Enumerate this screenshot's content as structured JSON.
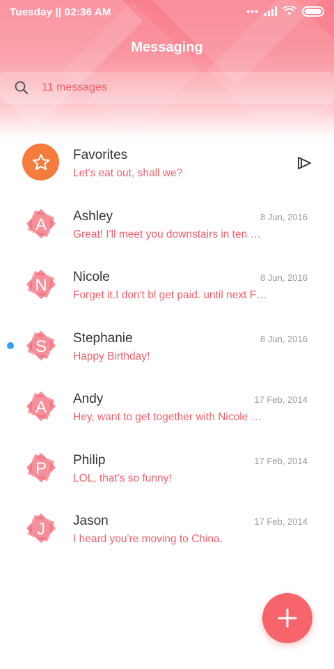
{
  "status_bar": {
    "time": "Tuesday || 02:36 AM",
    "signal_dots": "•••"
  },
  "header": {
    "title": "Messaging"
  },
  "search": {
    "text": "11 messages",
    "icon": "search-icon"
  },
  "favorites": {
    "name": "Favorites",
    "preview": "Let's eat out, shall we?",
    "icon": "star-icon",
    "action_icon": "send-icon",
    "avatar_color": "#f57c3c"
  },
  "conversations": [
    {
      "name": "Ashley",
      "date": "8 Jun, 2016",
      "preview": "Great! I'll meet you downstairs in ten …",
      "initial": "A",
      "unread": false
    },
    {
      "name": "Nicole",
      "date": "8 Jun, 2016",
      "preview": "Forget it.I don't bl get paid. until next F…",
      "initial": "N",
      "unread": false
    },
    {
      "name": "Stephanie",
      "date": "8 Jun, 2016",
      "preview": "Happy Birthday!",
      "initial": "S",
      "unread": true
    },
    {
      "name": "Andy",
      "date": "17 Feb, 2014",
      "preview": "Hey, want to get together with Nicole …",
      "initial": "A",
      "unread": false
    },
    {
      "name": "Philip",
      "date": "17 Feb, 2014",
      "preview": "LOL, that's so funny!",
      "initial": "P",
      "unread": false
    },
    {
      "name": "Jason",
      "date": "17 Feb, 2014",
      "preview": "I heard you're moving to China.",
      "initial": "J",
      "unread": false
    }
  ],
  "fab": {
    "icon": "plus-icon",
    "color": "#f8646c"
  },
  "colors": {
    "accent": "#f25f6c",
    "unread_dot": "#2ba3f0"
  }
}
